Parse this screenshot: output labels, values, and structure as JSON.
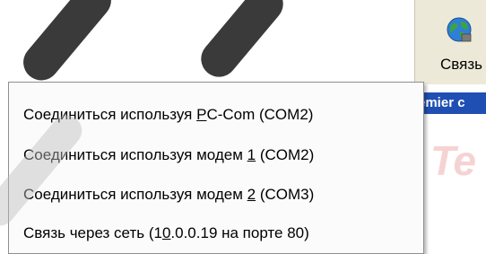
{
  "toolbar": {
    "connect_label": "Связь",
    "title_strip": "emier c",
    "bg_logo": "Te"
  },
  "menu": {
    "items": [
      {
        "pre": "Соединиться используя ",
        "u": "P",
        "post": "C-Com (COM2)"
      },
      {
        "pre": "Соединиться используя модем ",
        "u": "1",
        "post": " (COM2)"
      },
      {
        "pre": "Соединиться используя модем ",
        "u": "2",
        "post": " (COM3)"
      },
      {
        "pre": "Связь через сеть (1",
        "u": "0",
        "post": ".0.0.19 на порте 80)"
      }
    ]
  },
  "icons": {
    "globe": "globe-network-icon"
  }
}
